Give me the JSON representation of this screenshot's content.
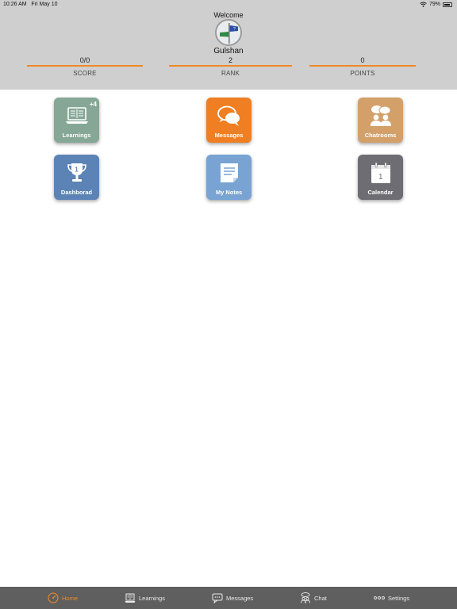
{
  "status": {
    "time": "10:26 AM",
    "date": "Fri May 10",
    "battery": "79%"
  },
  "header": {
    "welcome": "Welcome",
    "username": "Gulshan",
    "stats": [
      {
        "value": "0/0",
        "label": "SCORE"
      },
      {
        "value": "2",
        "label": "RANK"
      },
      {
        "value": "0",
        "label": "POINTS"
      }
    ]
  },
  "tiles": [
    {
      "label": "Learnings",
      "color": "#86a796",
      "icon": "laptop-book-icon",
      "badge": "+4"
    },
    {
      "label": "Messages",
      "color": "#ef7f22",
      "icon": "chat-bubbles-icon"
    },
    {
      "label": "Chatrooms",
      "color": "#d4a06a",
      "icon": "group-chat-icon"
    },
    {
      "label": "Dashborad",
      "color": "#5b83b5",
      "icon": "trophy-icon"
    },
    {
      "label": "My Notes",
      "color": "#78a3d3",
      "icon": "note-icon"
    },
    {
      "label": "Calendar",
      "color": "#6d6d73",
      "icon": "calendar-icon"
    }
  ],
  "tabbar": {
    "active_color": "#f08a24",
    "items": [
      {
        "label": "Home",
        "icon": "speedometer-icon"
      },
      {
        "label": "Learnings",
        "icon": "book-icon"
      },
      {
        "label": "Messages",
        "icon": "message-icon"
      },
      {
        "label": "Chat",
        "icon": "people-icon"
      },
      {
        "label": "Settings",
        "icon": "dots-icon"
      }
    ]
  }
}
